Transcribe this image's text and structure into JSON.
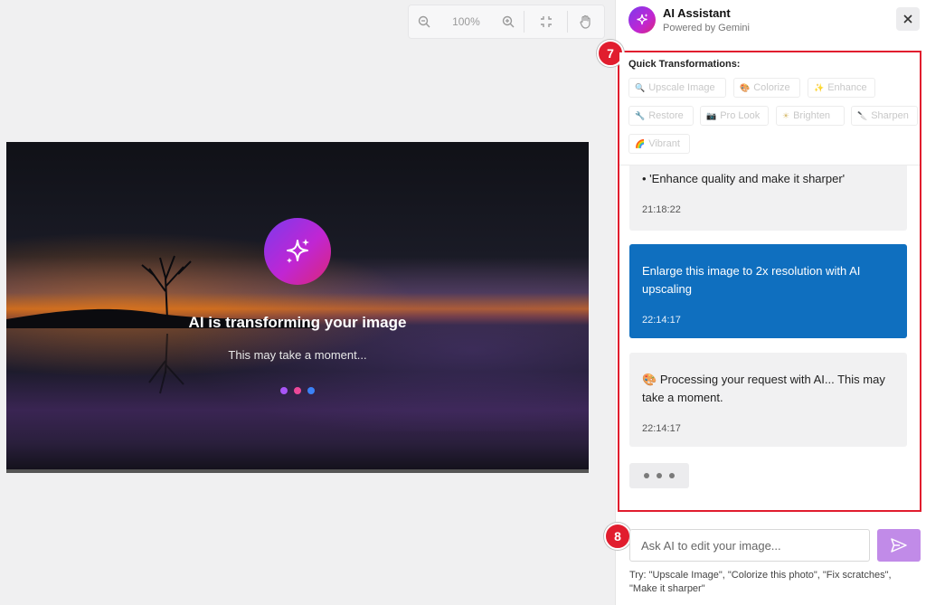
{
  "toolbar": {
    "zoom_level": "100%",
    "icons": [
      "zoom-out-icon",
      "zoom-in-icon",
      "fit-screen-icon",
      "pan-hand-icon"
    ]
  },
  "overlay": {
    "title": "AI is transforming your image",
    "subtitle": "This may take a moment...",
    "dot_colors": [
      "#a855f7",
      "#ec4899",
      "#3b82f6"
    ]
  },
  "panel": {
    "title": "AI Assistant",
    "subtitle": "Powered by Gemini"
  },
  "steps": {
    "a": "7",
    "b": "8"
  },
  "quick": {
    "title": "Quick Transformations:",
    "items": [
      "Upscale Image",
      "Colorize",
      "Enhance",
      "Restore",
      "Pro Look",
      "Brighten",
      "Sharpen",
      "Vibrant"
    ]
  },
  "messages": {
    "m1_line": "• 'Enhance quality and make it sharper'",
    "m1_time": "21:18:22",
    "m2_text": "Enlarge this image to 2x resolution with AI upscaling",
    "m2_time": "22:14:17",
    "m3_text": "Processing your request with AI... This may take a moment.",
    "m3_time": "22:14:17"
  },
  "input": {
    "placeholder": "Ask AI to edit your image..."
  },
  "hint": "Try: \"Upscale Image\", \"Colorize this photo\", \"Fix scratches\", \"Make it sharper\"",
  "colors": {
    "accent": "#e11d2e",
    "user_bubble": "#0f6fbf",
    "send": "#c18be8"
  }
}
